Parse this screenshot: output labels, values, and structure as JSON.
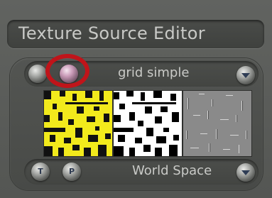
{
  "title": "Texture Source Editor",
  "source": {
    "name": "grid simple",
    "space": "World Space"
  },
  "buttons": {
    "t": "T",
    "p": "P"
  },
  "colors": {
    "background": "#5a5c59",
    "label": "#c9cac7",
    "highlight_ring": "#c0141a",
    "preview_yellow": "#f2ea1c"
  },
  "icons": [
    "eye-toggle-icon",
    "pink-radio-icon",
    "dropdown-chevron-icon",
    "t-button-icon",
    "p-button-icon"
  ]
}
